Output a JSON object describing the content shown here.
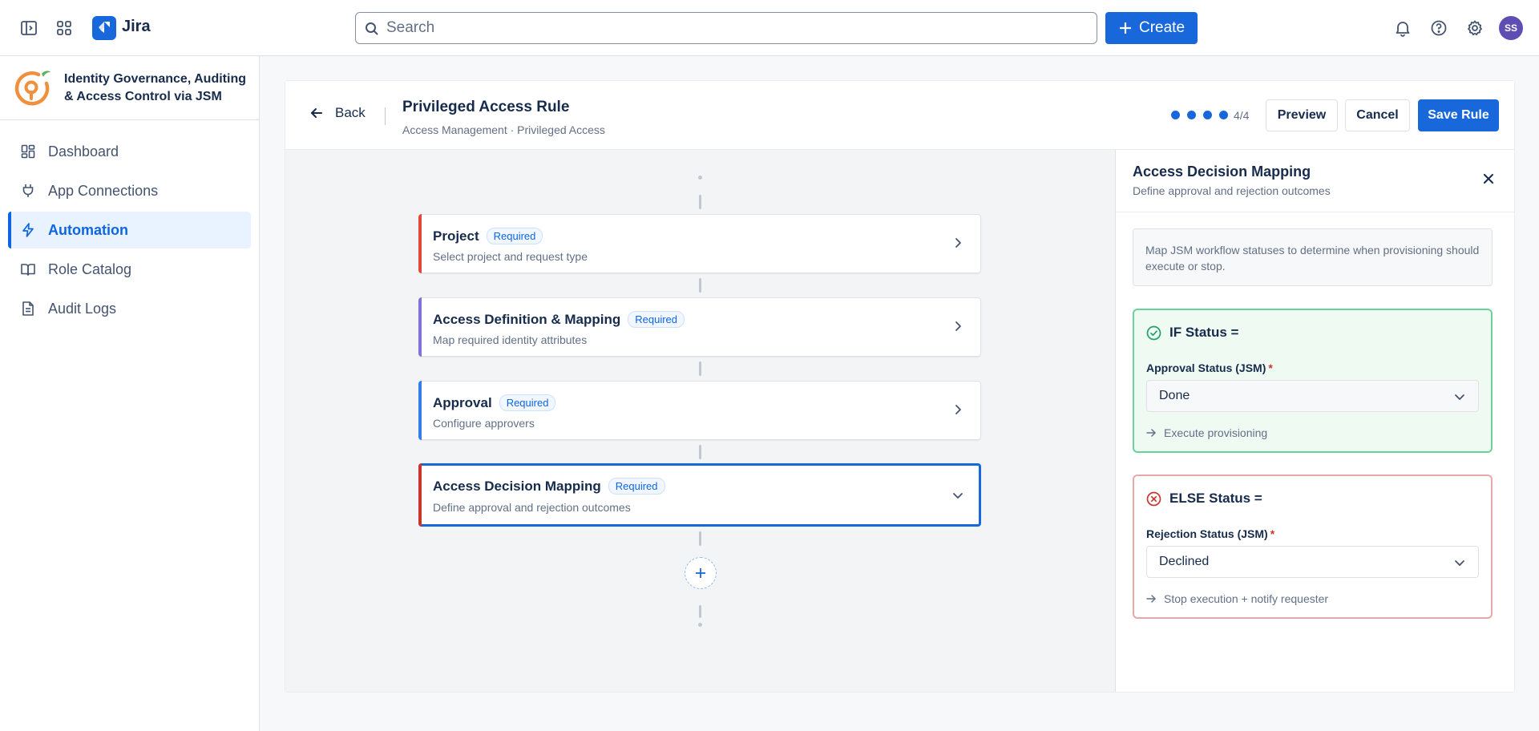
{
  "topbar": {
    "app_name": "Jira",
    "search_placeholder": "Search",
    "create_label": "Create",
    "avatar_initials": "SS"
  },
  "sidebar": {
    "app_title": "Identity Governance, Auditing & Access Control via JSM",
    "items": [
      {
        "label": "Dashboard",
        "icon": "dashboard-icon",
        "active": false
      },
      {
        "label": "App Connections",
        "icon": "plug-icon",
        "active": false
      },
      {
        "label": "Automation",
        "icon": "lightning-icon",
        "active": true
      },
      {
        "label": "Role Catalog",
        "icon": "book-icon",
        "active": false
      },
      {
        "label": "Audit Logs",
        "icon": "document-icon",
        "active": false
      }
    ]
  },
  "rule": {
    "back_label": "Back",
    "title": "Privileged Access Rule",
    "breadcrumb": "Access Management · Privileged Access",
    "progress_steps": 4,
    "progress_label": "4/4",
    "preview_label": "Preview",
    "cancel_label": "Cancel",
    "save_label": "Save Rule"
  },
  "steps": [
    {
      "title": "Project",
      "badge": "Required",
      "subtitle": "Select project and request type",
      "accent": "#e2483d",
      "expanded": false
    },
    {
      "title": "Access Definition & Mapping",
      "badge": "Required",
      "subtitle": "Map required identity attributes",
      "accent": "#8270db",
      "expanded": false
    },
    {
      "title": "Approval",
      "badge": "Required",
      "subtitle": "Configure approvers",
      "accent": "#357de8",
      "expanded": false
    },
    {
      "title": "Access Decision Mapping",
      "badge": "Required",
      "subtitle": "Define approval and rejection outcomes",
      "accent": "#c9372c",
      "expanded": true
    }
  ],
  "panel": {
    "title": "Access Decision Mapping",
    "subtitle": "Define approval and rejection outcomes",
    "info": "Map JSM workflow statuses to determine when provisioning should execute or stop.",
    "if_block": {
      "heading": "IF Status =",
      "field_label": "Approval Status (JSM)",
      "required_mark": "*",
      "value": "Done",
      "outcome": "Execute provisioning"
    },
    "else_block": {
      "heading": "ELSE Status =",
      "field_label": "Rejection Status (JSM)",
      "required_mark": "*",
      "value": "Declined",
      "outcome": "Stop execution + notify requester"
    }
  },
  "colors": {
    "primary": "#1868db",
    "success_border": "#6bd39a",
    "success_bg": "#effaf3",
    "danger_border": "#e6a9a9",
    "danger_icon": "#c9372c",
    "app_logo": "#f0903c"
  }
}
